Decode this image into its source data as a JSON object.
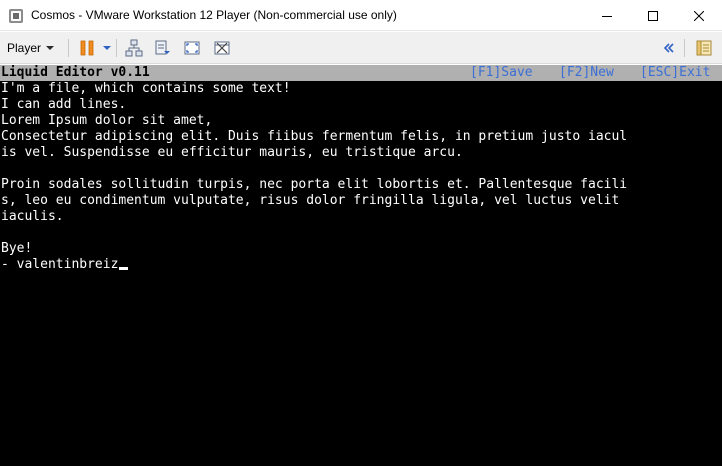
{
  "window": {
    "title": "Cosmos - VMware Workstation 12 Player (Non-commercial use only)",
    "icons": {
      "app": "vmware-app-icon",
      "minimize": "minimize-icon",
      "maximize": "maximize-icon",
      "close": "close-icon"
    }
  },
  "toolbar": {
    "player_label": "Player",
    "icons": [
      "pause-icon",
      "network-adapter-icon",
      "send-ctrl-alt-del-icon",
      "fullscreen-icon",
      "unity-icon",
      "collapse-chevrons-icon",
      "library-icon"
    ],
    "accent_color": "#f08c1e"
  },
  "editor": {
    "title": "Liquid Editor v0.11",
    "actions": {
      "save": "[F1]Save",
      "new": "[F2]New",
      "exit": "[ESC]Exit"
    },
    "action_color": "#3b6fd6",
    "header_bg": "#b0b0b0",
    "lines": [
      "I'm a file, which contains some text!",
      "I can add lines.",
      "Lorem Ipsum dolor sit amet,",
      "Consectetur adipiscing elit. Duis fiibus fermentum felis, in pretium justo iacul",
      "is vel. Suspendisse eu efficitur mauris, eu tristique arcu.",
      "",
      "Proin sodales sollitudin turpis, nec porta elit lobortis et. Pallentesque facili",
      "s, leo eu condimentum vulputate, risus dolor fringilla ligula, vel luctus velit",
      "iaculis.",
      "",
      "Bye!",
      "- valentinbreiz"
    ]
  }
}
